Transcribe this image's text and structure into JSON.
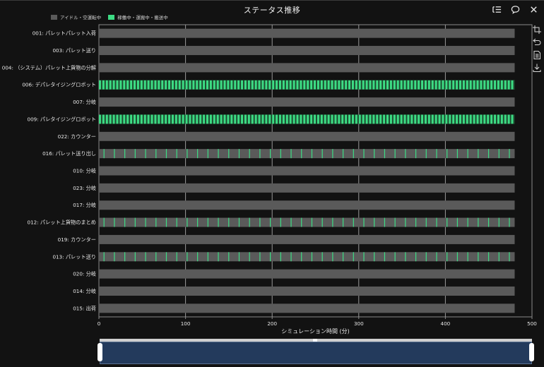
{
  "title": "ステータス推移",
  "legend": [
    {
      "label": "アイドル・空運転中",
      "color": "#5a5a5a"
    },
    {
      "label": "稼働中・運搬中・搬送中",
      "color": "#3ddc84"
    }
  ],
  "toolbar": [
    {
      "name": "list-icon"
    },
    {
      "name": "comment-icon"
    },
    {
      "name": "close-icon"
    }
  ],
  "side_tools": [
    {
      "name": "crop-icon"
    },
    {
      "name": "undo-icon"
    },
    {
      "name": "document-icon"
    },
    {
      "name": "download-icon"
    }
  ],
  "colors": {
    "idle": "#5a5a5a",
    "active": "#3ddc84",
    "grid": "#9a9a9a",
    "background": "#121212"
  },
  "chart_data": {
    "type": "timeline",
    "title": "ステータス推移",
    "xlabel": "シミュレーション時間 (分)",
    "xlim": [
      0,
      500
    ],
    "bar_end": 480,
    "xticks": [
      0,
      100,
      200,
      300,
      400,
      500
    ],
    "grid": true,
    "legend_position": "top-left",
    "categories": [
      {
        "label": "001: パレットパレット入荷",
        "state": "idle",
        "active_pulses": 0
      },
      {
        "label": "003: パレット送り",
        "state": "idle",
        "active_pulses": 0
      },
      {
        "label": "004: （システム）パレット上貨物の分解",
        "state": "idle",
        "active_pulses": 0
      },
      {
        "label": "006: デパレタイジングロボット",
        "state": "mixed",
        "active_pulses": 120
      },
      {
        "label": "007: 分岐",
        "state": "idle",
        "active_pulses": 0
      },
      {
        "label": "009: パレタイジングロボット",
        "state": "mixed",
        "active_pulses": 120
      },
      {
        "label": "022: カウンター",
        "state": "idle",
        "active_pulses": 0
      },
      {
        "label": "016: パレット送り出し",
        "state": "mixed",
        "active_pulses": 40
      },
      {
        "label": "010: 分岐",
        "state": "idle",
        "active_pulses": 0
      },
      {
        "label": "023: 分岐",
        "state": "idle",
        "active_pulses": 0
      },
      {
        "label": "017: 分岐",
        "state": "idle",
        "active_pulses": 0
      },
      {
        "label": "012: パレット上貨物のまとめ",
        "state": "mixed",
        "active_pulses": 40
      },
      {
        "label": "019: カウンター",
        "state": "idle",
        "active_pulses": 0
      },
      {
        "label": "013: パレット送り",
        "state": "mixed",
        "active_pulses": 40
      },
      {
        "label": "020: 分岐",
        "state": "idle",
        "active_pulses": 0
      },
      {
        "label": "014: 分岐",
        "state": "idle",
        "active_pulses": 0
      },
      {
        "label": "015: 出荷",
        "state": "idle",
        "active_pulses": 0
      }
    ]
  },
  "zoom_slider": {
    "start": 0,
    "end": 100
  }
}
